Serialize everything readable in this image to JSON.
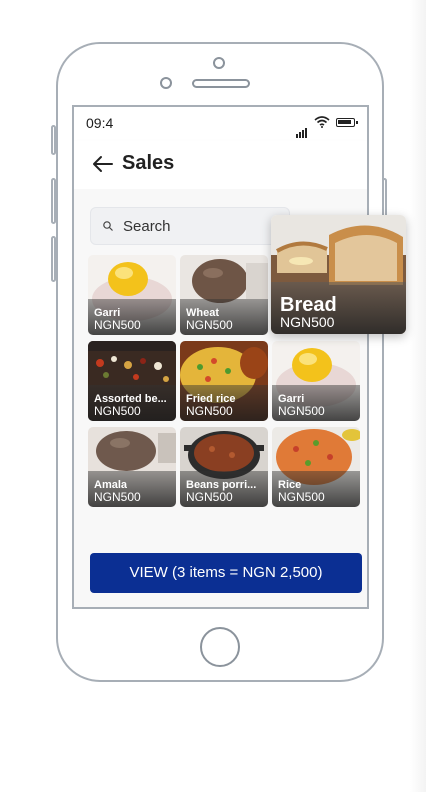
{
  "status_bar": {
    "time": "09:4"
  },
  "header": {
    "title": "Sales"
  },
  "search": {
    "placeholder": "Search"
  },
  "items": [
    {
      "name": "Garri",
      "price": "NGN500",
      "icon": "garri-image"
    },
    {
      "name": "Wheat",
      "price": "NGN500",
      "icon": "wheat-swallow-image"
    },
    {
      "name": "Assorted be...",
      "price": "NGN500",
      "icon": "assorted-beans-image"
    },
    {
      "name": "Fried rice",
      "price": "NGN500",
      "icon": "fried-rice-image"
    },
    {
      "name": "Garri",
      "price": "NGN500",
      "icon": "garri-image"
    },
    {
      "name": "Amala",
      "price": "NGN500",
      "icon": "amala-image"
    },
    {
      "name": "Beans porri...",
      "price": "NGN500",
      "icon": "beans-porridge-image"
    },
    {
      "name": "Rice",
      "price": "NGN500",
      "icon": "jollof-rice-image"
    }
  ],
  "dragging_item": {
    "name": "Bread",
    "price": "NGN500",
    "icon": "bread-image"
  },
  "footer": {
    "view_label": "VIEW (3 items = NGN 2,500)"
  },
  "colors": {
    "primary_button": "#0b2f93",
    "background": "#f8f8f8"
  }
}
